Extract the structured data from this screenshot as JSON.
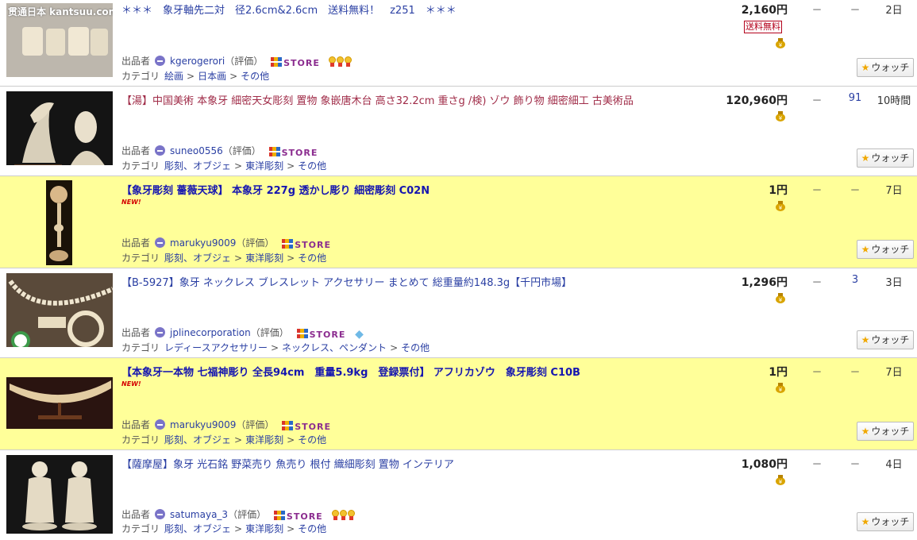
{
  "labels": {
    "seller_label": "出品者",
    "rating_label": "（評価）",
    "category_label": "カテゴリ",
    "watch_label": "ウォッチ",
    "store_label": "STORE",
    "shipping_free_badge": "送料無料",
    "new_badge": "NEW!",
    "watermark": "贯通日本 kantsuu.com"
  },
  "colors": {
    "highlight_row": "#ffff99",
    "title_link": "#2a3fa3",
    "store_purple": "#8b2c8f"
  },
  "items": [
    {
      "title": "＊＊＊　象牙軸先二対　径2.6cm&2.6cm　送料無料！　z251　＊＊＊",
      "price": "2,160円",
      "shipping_free": true,
      "bids": "－",
      "watchers": "－",
      "remaining": "2日",
      "seller": "kgerogerori",
      "categories": [
        "絵画",
        "日本画",
        "その他"
      ]
    },
    {
      "title": "【湯】中国美術 本象牙 細密天女彫刻 置物 象嵌唐木台 高さ32.2cm 重さg /検) ゾウ 飾り物 細密細工 古美術品",
      "price": "120,960円",
      "bids": "－",
      "watchers": "91",
      "remaining": "10時間",
      "seller": "suneo0556",
      "categories": [
        "彫刻、オブジェ",
        "東洋彫刻",
        "その他"
      ]
    },
    {
      "title": "【象牙彫刻 薔薇天球】 本象牙 227g 透かし彫り 細密彫刻 C02N",
      "price": "1円",
      "bids": "－",
      "watchers": "－",
      "remaining": "7日",
      "seller": "marukyu9009",
      "categories": [
        "彫刻、オブジェ",
        "東洋彫刻",
        "その他"
      ]
    },
    {
      "title": "【B-5927】象牙 ネックレス ブレスレット アクセサリー まとめて 総重量約148.3g【千円市場】",
      "price": "1,296円",
      "bids": "－",
      "watchers": "3",
      "remaining": "3日",
      "seller": "jplinecorporation",
      "categories": [
        "レディースアクセサリー",
        "ネックレス、ペンダント",
        "その他"
      ]
    },
    {
      "title": "【本象牙一本物 七福神彫り 全長94cm　重量5.9kg　登録票付】 アフリカゾウ　象牙彫刻 C10B",
      "price": "1円",
      "bids": "－",
      "watchers": "－",
      "remaining": "7日",
      "seller": "marukyu9009",
      "categories": [
        "彫刻、オブジェ",
        "東洋彫刻",
        "その他"
      ]
    },
    {
      "title": "【薩摩屋】象牙 光石銘 野菜売り 魚売り 根付 織細彫刻 置物 インテリア",
      "price": "1,080円",
      "bids": "－",
      "watchers": "－",
      "remaining": "4日",
      "seller": "satumaya_3",
      "categories": [
        "彫刻、オブジェ",
        "東洋彫刻",
        "その他"
      ]
    }
  ]
}
